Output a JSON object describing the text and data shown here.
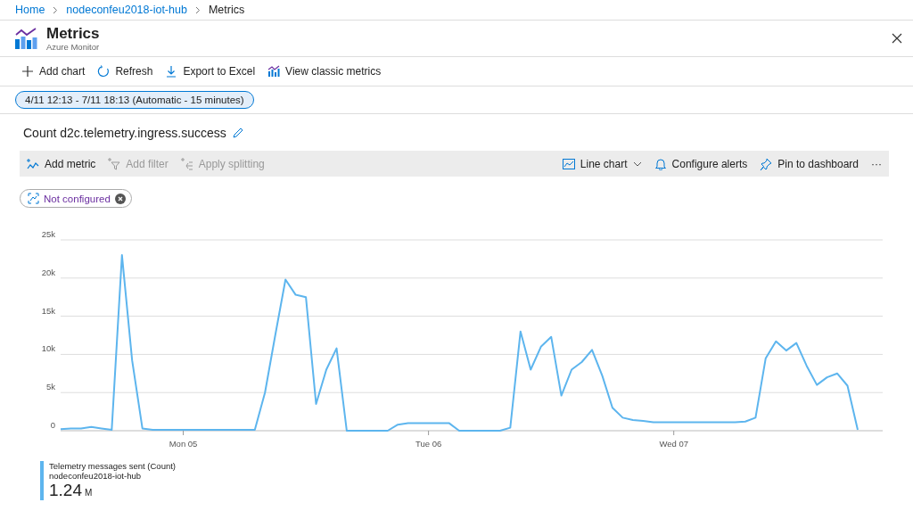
{
  "breadcrumb": [
    {
      "label": "Home",
      "kind": "link"
    },
    {
      "label": "nodeconfeu2018-iot-hub",
      "kind": "link"
    },
    {
      "label": "Metrics",
      "kind": "current"
    }
  ],
  "header": {
    "title": "Metrics",
    "subtitle": "Azure Monitor"
  },
  "toolbar": [
    {
      "label": "Add chart",
      "kind": "plus"
    },
    {
      "label": "Refresh",
      "kind": "refresh"
    },
    {
      "label": "Export to Excel",
      "kind": "download"
    },
    {
      "label": "View classic metrics",
      "kind": "classic"
    }
  ],
  "time_range": "4/11 12:13 - 7/11 18:13 (Automatic - 15 minutes)",
  "chart_title": "Count d2c.telemetry.ingress.success",
  "chart_toolbar_left": [
    {
      "label": "Add metric",
      "kind": "metric",
      "disabled": false
    },
    {
      "label": "Add filter",
      "kind": "filter",
      "disabled": true
    },
    {
      "label": "Apply splitting",
      "kind": "split",
      "disabled": true
    }
  ],
  "chart_toolbar_right": [
    {
      "label": "Line chart",
      "kind": "linechart"
    },
    {
      "label": "Configure alerts",
      "kind": "bell"
    },
    {
      "label": "Pin to dashboard",
      "kind": "pin"
    },
    {
      "label": "···",
      "kind": "more"
    }
  ],
  "scope_chip": "Not configured",
  "chart": {
    "chart_data": {
      "type": "line",
      "categories": [
        null,
        null,
        null,
        null,
        null,
        null,
        null,
        null,
        null,
        null,
        null,
        null,
        "Mon 05",
        null,
        null,
        null,
        null,
        null,
        null,
        null,
        null,
        null,
        null,
        null,
        null,
        null,
        null,
        null,
        null,
        null,
        null,
        null,
        null,
        null,
        null,
        null,
        "Tue 06",
        null,
        null,
        null,
        null,
        null,
        null,
        null,
        null,
        null,
        null,
        null,
        null,
        null,
        null,
        null,
        null,
        null,
        null,
        null,
        null,
        null,
        null,
        null,
        "Wed 07",
        null,
        null,
        null,
        null,
        null,
        null,
        null,
        null,
        null,
        null,
        null,
        null,
        null,
        null,
        null,
        null,
        null,
        null
      ],
      "series": [
        {
          "name": "Telemetry messages sent (Count)",
          "color": "#5db5ee",
          "values": [
            200,
            300,
            300,
            500,
            300,
            100,
            23000,
            9200,
            300,
            100,
            100,
            100,
            100,
            100,
            100,
            100,
            100,
            100,
            100,
            100,
            5000,
            12500,
            19800,
            17800,
            17500,
            3500,
            8000,
            10800,
            0,
            0,
            0,
            0,
            0,
            800,
            1000,
            1000,
            1000,
            1000,
            1000,
            0,
            0,
            0,
            0,
            0,
            400,
            13000,
            8000,
            11000,
            12300,
            4600,
            8000,
            9000,
            10600,
            7200,
            3000,
            1700,
            1400,
            1300,
            1100,
            1100,
            1100,
            1100,
            1100,
            1100,
            1100,
            1100,
            1100,
            1200,
            1700,
            9500,
            11700,
            10500,
            11500,
            8500,
            6000,
            7000,
            7500,
            5900,
            100
          ]
        }
      ],
      "ylim": [
        0,
        25000
      ],
      "grid": true,
      "yticks": [
        {
          "value": 0,
          "label": "0"
        },
        {
          "value": 5000,
          "label": "5k"
        },
        {
          "value": 10000,
          "label": "10k"
        },
        {
          "value": 15000,
          "label": "15k"
        },
        {
          "value": 20000,
          "label": "20k"
        },
        {
          "value": 25000,
          "label": "25k"
        }
      ]
    }
  },
  "legend": {
    "resource": "nodeconfeu2018-iot-hub",
    "total": "1.24",
    "unit": "M"
  }
}
